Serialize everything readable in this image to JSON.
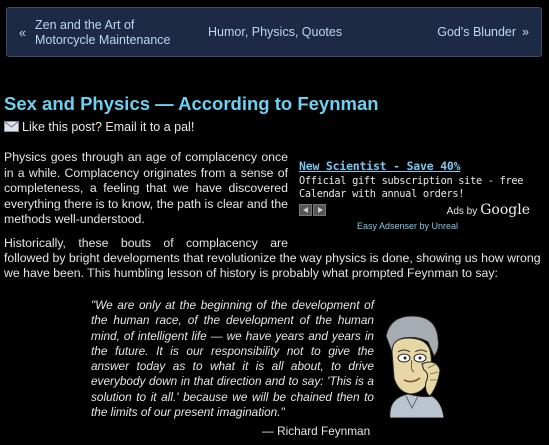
{
  "nav": {
    "prev_arrow": "«",
    "prev_label_line1": "Zen and the Art of",
    "prev_label_line2": "Motorcycle Maintenance",
    "category_label": "Humor, Physics, Quotes",
    "next_label": "God's Blunder",
    "next_arrow": "»"
  },
  "post": {
    "title": "Sex and Physics — According to Feynman",
    "email_link": "Like this post? Email it to a pal!",
    "para1": "Physics goes through an age of complacency once in a while. Complacency originates from a sense of completeness, a feeling that we have discovered everything there is to know, the path is clear and the methods well-understood.",
    "para2_line1": "Historically, these bouts of complacency are",
    "para2_rest": "followed by bright developments that revolutionize the way physics is done, showing us how wrong",
    "para2_line3": "we have been. This humbling lesson of history is probably what prompted Feynman to say:",
    "quote": "\"We are only at the beginning of the development of the human race, of the development of the human mind, of intelligent life — we have years and years in the future. It is our responsibility not to give the answer today as to what it is all about, to drive everybody down in that direction and to say: 'This is a solution to it all.' because we will be chained then to the limits of our present imagination.\"",
    "quote_author": "— Richard Feynman"
  },
  "ad": {
    "title": "New Scientist - Save 40%",
    "body": "Official gift subscription site - free Calendar with annual orders!",
    "ads_by": "Ads by",
    "google": "Google",
    "plugin_credit": "Easy Adsenser by Unreal"
  },
  "icons": {
    "email": "envelope-icon",
    "ad_prev": "arrow-left-icon",
    "ad_next": "arrow-right-icon"
  },
  "colors": {
    "background": "#000000",
    "title": "#6ed0f0",
    "nav_bg": "#1c2a44",
    "link": "#79c8ee"
  }
}
